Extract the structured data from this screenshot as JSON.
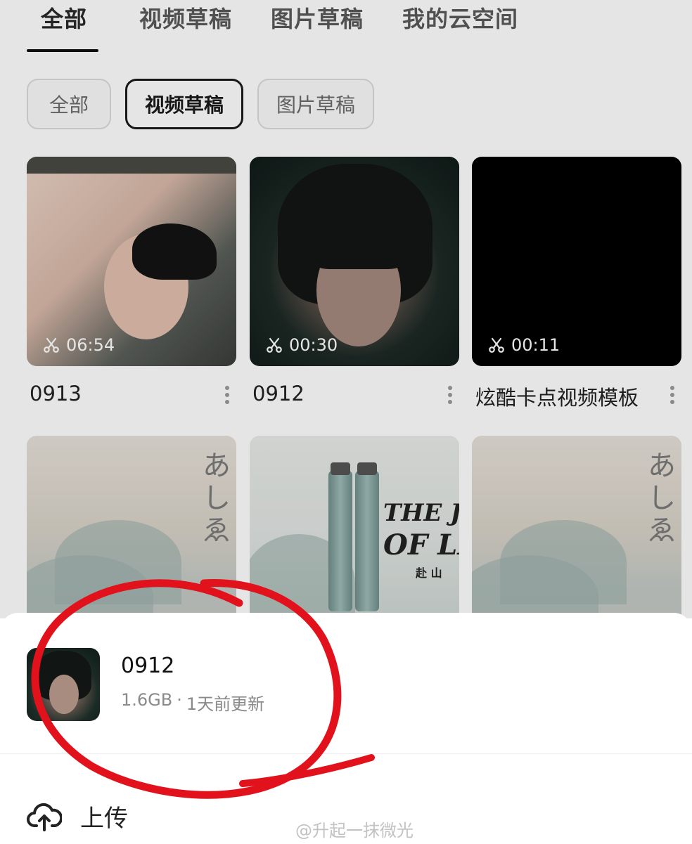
{
  "top_tabs": [
    {
      "label": "全部",
      "active": true
    },
    {
      "label": "视频草稿",
      "active": false
    },
    {
      "label": "图片草稿",
      "active": false
    },
    {
      "label": "我的云空间",
      "active": false
    }
  ],
  "filter_chips": [
    {
      "label": "全部",
      "active": false
    },
    {
      "label": "视频草稿",
      "active": true
    },
    {
      "label": "图片草稿",
      "active": false
    }
  ],
  "drafts": [
    {
      "title": "0913",
      "duration": "06:54"
    },
    {
      "title": "0912",
      "duration": "00:30"
    },
    {
      "title": "炫酷卡点视频模板",
      "duration": "00:11"
    }
  ],
  "poster": {
    "line1": "THE JO",
    "line2": "OF LE",
    "sub": "赴 山"
  },
  "sheet": {
    "title": "0912",
    "size": "1.6GB",
    "separator": "·",
    "updated": "1天前更新",
    "upload_label": "上传"
  },
  "watermark": "@升起一抹微光",
  "icons": {
    "duration": "scissors-icon",
    "more": "more-vertical-icon",
    "upload": "cloud-upload-icon"
  },
  "colors": {
    "annotation_circle": "#e2121c"
  }
}
